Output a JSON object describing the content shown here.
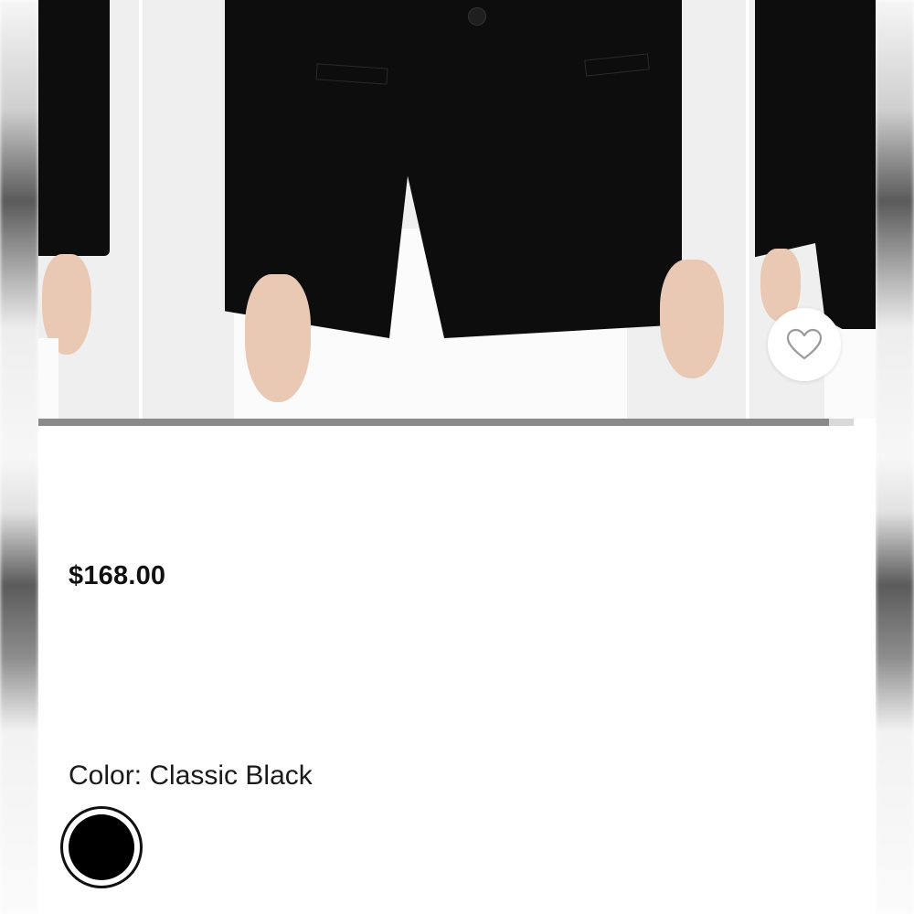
{
  "product": {
    "price": "$168.00",
    "color_label": "Color:",
    "color_value": "Classic Black",
    "swatches": [
      {
        "name": "Classic Black",
        "hex": "#000000",
        "selected": true
      }
    ],
    "favorite_icon": "heart-outline-icon"
  },
  "carousel": {
    "progress_fraction": 0.97
  },
  "colors": {
    "background": "#ffffff",
    "text": "#111111",
    "progress_track": "#d9d9d9",
    "progress_fill": "#8a8a8a",
    "heart_stroke": "#9a9a9a"
  }
}
